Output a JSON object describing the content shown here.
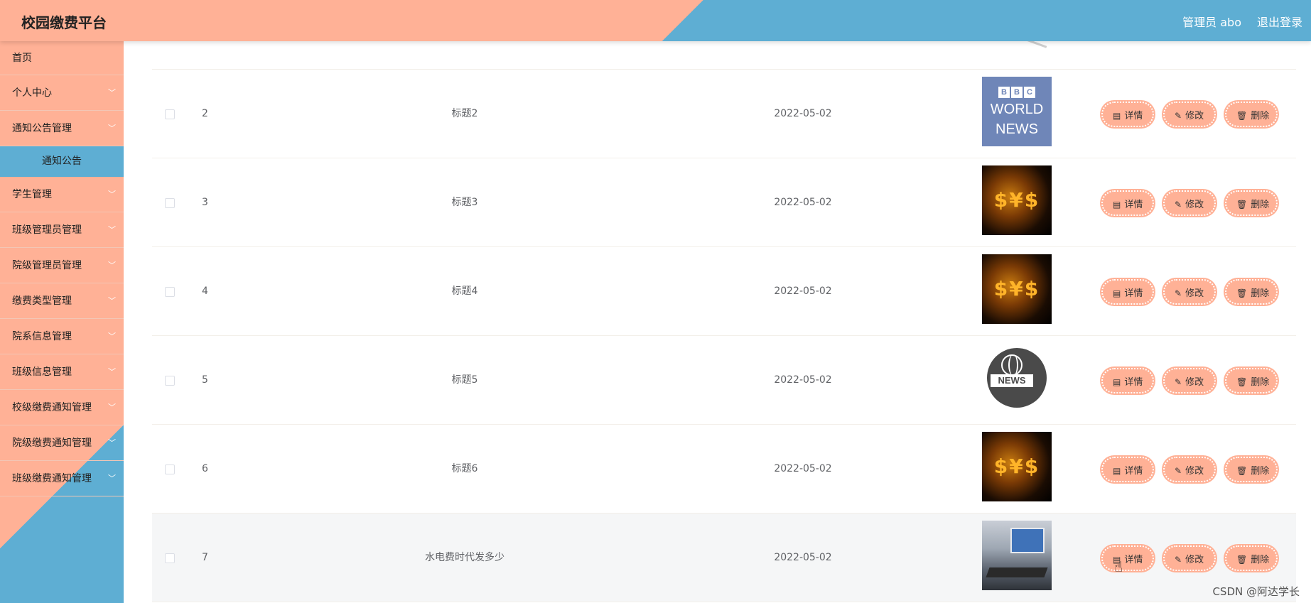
{
  "header": {
    "title": "校园缴费平台",
    "user_label": "管理员 abo",
    "logout_label": "退出登录"
  },
  "sidebar": {
    "items": [
      {
        "label": "首页"
      },
      {
        "label": "个人中心"
      },
      {
        "label": "通知公告管理"
      },
      {
        "label": "通知公告",
        "sub": true
      },
      {
        "label": "学生管理"
      },
      {
        "label": "班级管理员管理"
      },
      {
        "label": "院级管理员管理"
      },
      {
        "label": "缴费类型管理"
      },
      {
        "label": "院系信息管理"
      },
      {
        "label": "班级信息管理"
      },
      {
        "label": "校级缴费通知管理"
      },
      {
        "label": "院级缴费通知管理"
      },
      {
        "label": "班级缴费通知管理"
      }
    ],
    "chevron_icon": "chevron-down-icon"
  },
  "table": {
    "rows": [
      {
        "index": "2",
        "title": "标题2",
        "date": "2022-05-02",
        "image": "bbc-world-news"
      },
      {
        "index": "3",
        "title": "标题3",
        "date": "2022-05-02",
        "image": "dollar-fire"
      },
      {
        "index": "4",
        "title": "标题4",
        "date": "2022-05-02",
        "image": "dollar-fire"
      },
      {
        "index": "5",
        "title": "标题5",
        "date": "2022-05-02",
        "image": "news-globe"
      },
      {
        "index": "6",
        "title": "标题6",
        "date": "2022-05-02",
        "image": "dollar-fire"
      },
      {
        "index": "7",
        "title": "水电费时代发多少",
        "date": "2022-05-02",
        "image": "conference-room"
      }
    ],
    "actions": {
      "detail": "详情",
      "edit": "修改",
      "delete": "删除"
    },
    "thumb_text": {
      "bbc": [
        "B",
        "B",
        "C"
      ],
      "world": "WORLD",
      "news": "NEWS",
      "dollar": "$¥$",
      "news_badge": "NEWS"
    }
  },
  "watermark": "CSDN @阿达学长",
  "colors": {
    "accent_salmon": "#ffb196",
    "accent_blue": "#5eaed3"
  }
}
